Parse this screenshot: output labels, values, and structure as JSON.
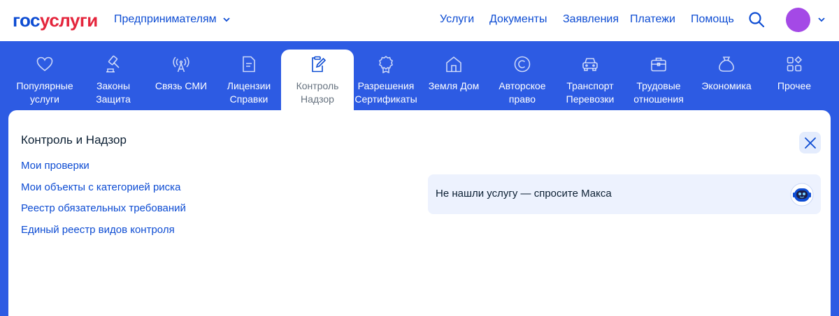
{
  "header": {
    "logo_part1": "гос",
    "logo_part2": "услуги",
    "segment": "Предпринимателям",
    "nav": [
      "Услуги",
      "Документы",
      "Заявления",
      "Платежи",
      "Помощь"
    ],
    "colors": {
      "brand_blue": "#0d4cd3",
      "brand_red": "#e4253c",
      "avatar": "#a449e6",
      "band": "#2d5be3"
    }
  },
  "categories": [
    {
      "label": "Популярные\nуслуги",
      "icon": "heart-icon"
    },
    {
      "label": "Законы\nЗащита",
      "icon": "gavel-icon"
    },
    {
      "label": "Связь СМИ",
      "icon": "antenna-icon"
    },
    {
      "label": "Лицензии\nСправки",
      "icon": "document-icon"
    },
    {
      "label": "Контроль\nНадзор",
      "icon": "clipboard-edit-icon",
      "active": true
    },
    {
      "label": "Разрешения\nСертификаты",
      "icon": "rosette-icon"
    },
    {
      "label": "Земля Дом",
      "icon": "house-icon"
    },
    {
      "label": "Авторское\nправо",
      "icon": "copyright-icon"
    },
    {
      "label": "Транспорт\nПеревозки",
      "icon": "car-icon"
    },
    {
      "label": "Трудовые\nотношения",
      "icon": "briefcase-icon"
    },
    {
      "label": "Экономика",
      "icon": "money-bag-icon"
    },
    {
      "label": "Прочее",
      "icon": "grid-icon"
    }
  ],
  "panel": {
    "title": "Контроль и Надзор",
    "links": [
      "Мои проверки",
      "Мои объекты с категорией риска",
      "Реестр обязательных требований",
      "Единый реестр видов контроля"
    ],
    "ask_text": "Не нашли услугу — спросите Макса"
  }
}
